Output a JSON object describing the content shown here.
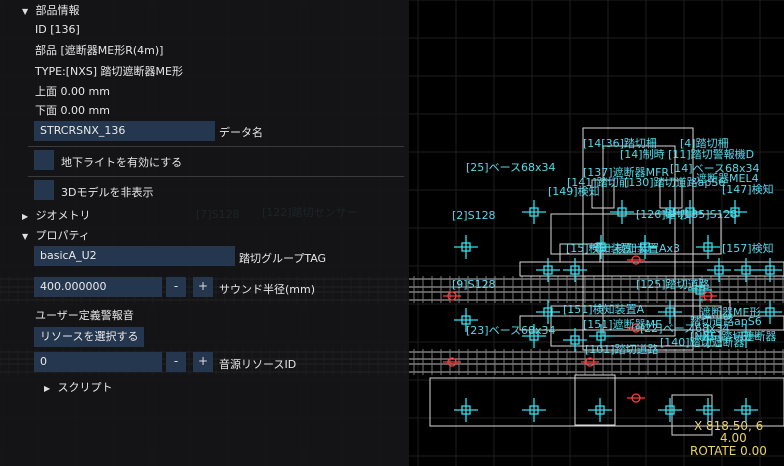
{
  "panel": {
    "section_part_info": "部品情報",
    "id_line": "ID [136]",
    "part_line": "部品 [遮断器ME形R(4m)]",
    "type_line": "TYPE:[NXS] 踏切遮断器ME形",
    "top_line": "上面 0.00 mm",
    "bottom_line": "下面 0.00 mm",
    "data_name_value": "STRCRSNX_136",
    "data_name_label": "データ名",
    "ground_light_label": "地下ライトを有効にする",
    "hide_3d_label": "3Dモデルを非表示",
    "section_geometry": "ジオメトリ",
    "section_property": "プロパティ",
    "crossing_group_value": "basicA_U2",
    "crossing_group_label": "踏切グループTAG",
    "sound_radius_value": "400.000000",
    "sound_radius_label": "サウンド半径(mm)",
    "minus": "-",
    "plus": "+",
    "user_alarm_label": "ユーザー定義警報音",
    "select_resource_button": "リソースを選択する",
    "sound_resource_value": "0",
    "sound_resource_label": "音源リソースID",
    "section_script": "スクリプト"
  },
  "viewport": {
    "labels": [
      "[14[36]踏切柵",
      "[4]踏切柵",
      "[14]制時 [11]踏切警報機D",
      "[25]ベース68x34",
      "[137]遮断器MFR",
      "[14]ベース68x34",
      "[141]踏切前",
      "[130]踏切道路apS6",
      "遮断器MEL4",
      "[149]検知",
      "[147]検知",
      "[7]S128",
      "[122]踏切センサー",
      "[2]S128",
      "[126]踏切",
      "[135]S128",
      "[157]検知",
      "[9]S128",
      "[125]踏切道路",
      "[15]検知装置",
      "[23]ベース68x34",
      "[151]遮断器ME",
      "[22]ベース68x34",
      "[101]踏切道路",
      "[140]踏切遮断器",
      "[NXS]踏切遮断器",
      "踏切道路apS6",
      "遮断器ME形",
      "検知装置Ax3",
      "[151]検知装置A"
    ],
    "coords": "X 818.50, 6",
    "z": "4.00",
    "rotate": "ROTATE 0.00"
  }
}
